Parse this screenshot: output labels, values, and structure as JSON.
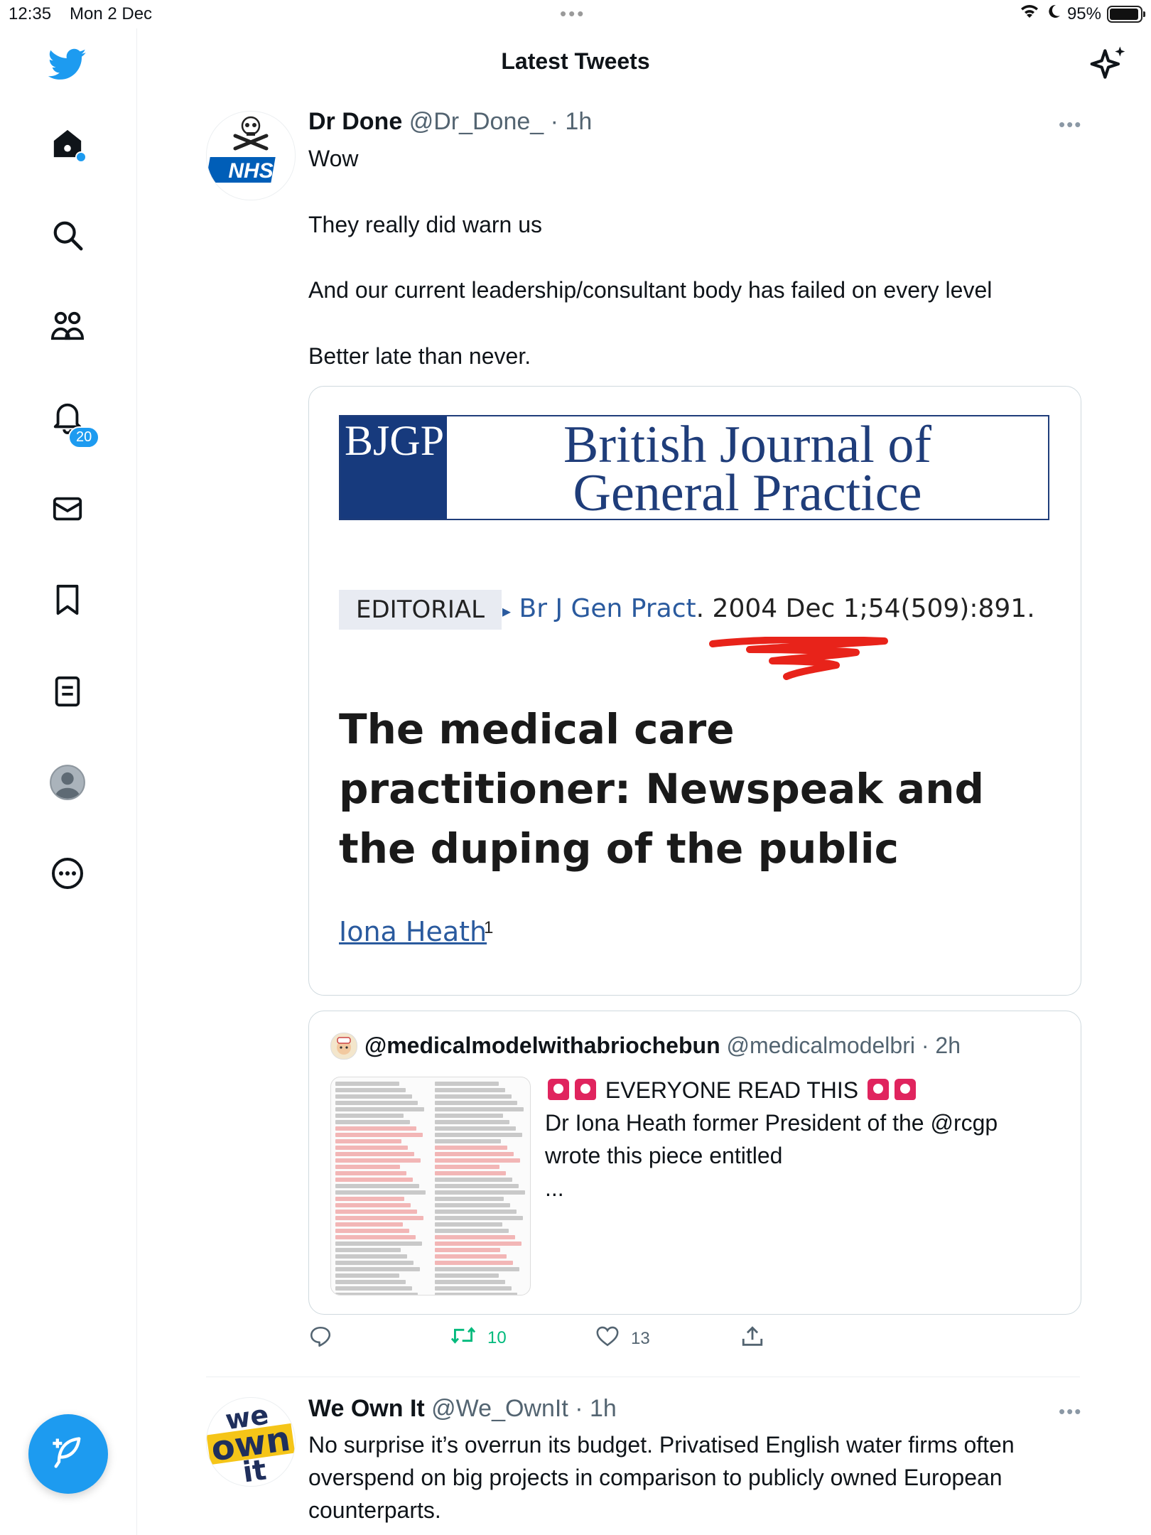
{
  "status_bar": {
    "time": "12:35",
    "date": "Mon 2 Dec",
    "multitask_dots": "•••",
    "battery_percent": "95%",
    "battery_level": 0.95
  },
  "sidebar": {
    "notifications_badge": "20"
  },
  "header": {
    "title": "Latest Tweets"
  },
  "tweet1": {
    "avatar_text": "NHS",
    "name": "Dr Done",
    "handle": "@Dr_Done_",
    "time": "· 1h",
    "more": "•••",
    "lines": [
      "Wow",
      "They really did warn us",
      "And our current leadership/consultant body has failed on every level",
      "Better late than never."
    ],
    "media": {
      "logo_left": "BJGP",
      "logo_line1": "British Journal of",
      "logo_line2": "General Practice",
      "tag": "EDITORIAL",
      "triangle": "▸",
      "journal": "Br J Gen Pract",
      "citation_rest": ". 2004 Dec 1;54(509):891.",
      "title": "The medical care practitioner: Newspeak and the duping of the public",
      "author": "Iona Heath",
      "author_sup": "1"
    },
    "quote": {
      "name": "@medicalmodelwithabriochebun",
      "handle": "@medicalmodelbri",
      "time": "· 2h",
      "line1": "EVERYONE READ THIS",
      "line2": "Dr Iona Heath former President of the  @rcgp",
      "line3": "wrote this piece entitled",
      "ellipsis": "..."
    },
    "actions": {
      "retweets": "10",
      "likes": "13"
    }
  },
  "tweet2": {
    "avatar_line1": "we",
    "avatar_line2": "own",
    "avatar_line3": "it",
    "name": "We Own It",
    "handle": "@We_OwnIt",
    "time": "· 1h",
    "more": "•••",
    "text": "No surprise it’s overrun its budget. Privatised English water firms often overspend on big projects in comparison to publicly owned European counterparts."
  },
  "colors": {
    "accent": "#1d9bf0",
    "retweet_green": "#00ba7c",
    "journal_blue": "#1f3d7a",
    "scribble_red": "#e8231a"
  }
}
